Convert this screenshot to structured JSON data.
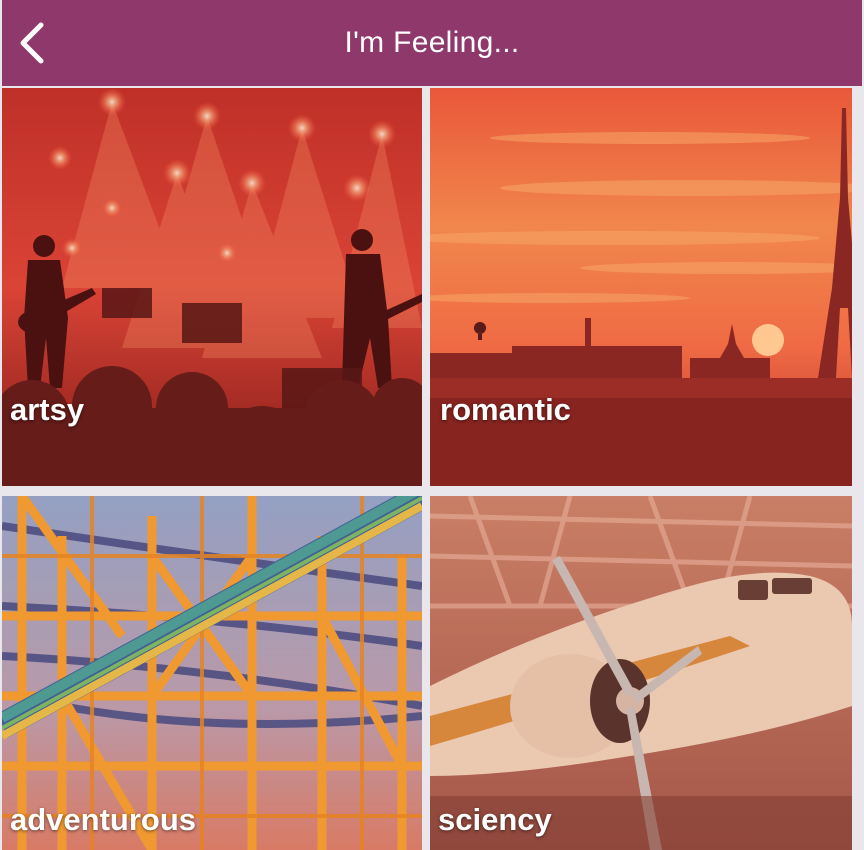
{
  "header": {
    "title": "I'm Feeling...",
    "back_icon": "chevron-left-icon"
  },
  "colors": {
    "navbar": "#8f386b",
    "background": "#e9e6ec",
    "label": "#ffffff"
  },
  "moods": [
    {
      "label": "artsy"
    },
    {
      "label": "romantic"
    },
    {
      "label": "adventurous"
    },
    {
      "label": "sciency"
    }
  ]
}
